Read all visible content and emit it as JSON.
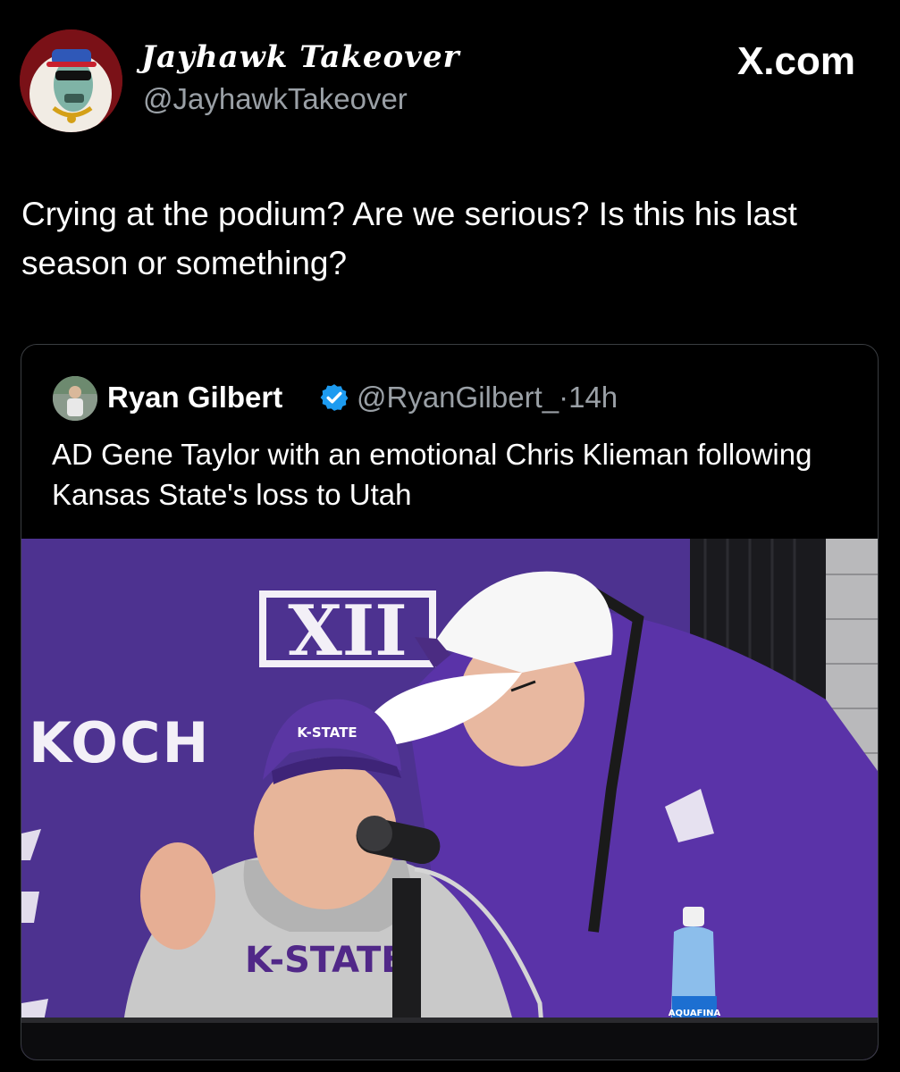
{
  "author": {
    "display_name": "Jayhawk Takeover",
    "handle": "@JayhawkTakeover",
    "avatar_icon": "cartoon-avatar-icon"
  },
  "source_label": "X.com",
  "tweet": {
    "text": "Crying at the podium?  Are we serious?  Is this his last season or something?"
  },
  "quoted_tweet": {
    "author_name": "Ryan Gilbert",
    "verified": true,
    "handle": "@RyanGilbert_",
    "separator": "·",
    "timestamp": "14h",
    "text": "AD Gene Taylor with an emotional Chris Klieman following Kansas State's loss to Utah",
    "photo": {
      "backdrop_logo": "XII",
      "backdrop_sponsor": "KOCH",
      "cap_text": "K-STATE",
      "hoodie_text": "K-STATE",
      "bottle_label": "AQUAFINA"
    }
  },
  "colors": {
    "background": "#000000",
    "verified_blue": "#1d9bf0",
    "kstate_purple": "#512888",
    "backdrop_purple": "#4a2f8c"
  }
}
